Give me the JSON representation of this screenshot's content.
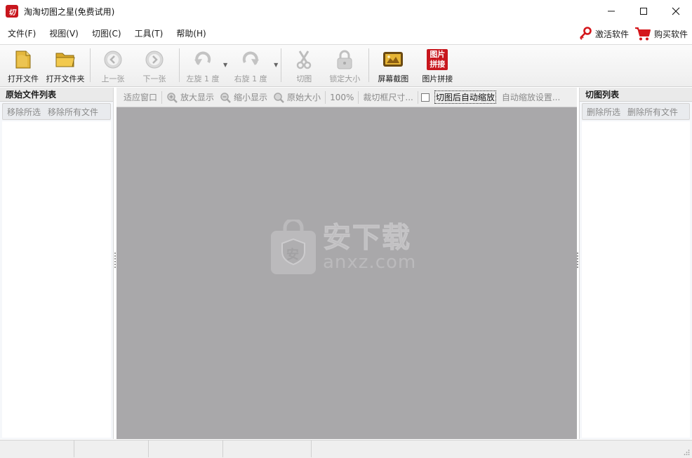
{
  "window": {
    "title": "淘淘切图之星(免费试用)",
    "logo_text": "切"
  },
  "menu": {
    "items": [
      {
        "label": "文件(F)"
      },
      {
        "label": "视图(V)"
      },
      {
        "label": "切图(C)"
      },
      {
        "label": "工具(T)"
      },
      {
        "label": "帮助(H)"
      }
    ],
    "activate": "激活软件",
    "buy": "购买软件"
  },
  "toolbar": {
    "open_file": "打开文件",
    "open_folder": "打开文件夹",
    "prev": "上一张",
    "next": "下一张",
    "rotate_left": "左旋 1 度",
    "rotate_right": "右旋 1 度",
    "cut": "切图",
    "lock_size": "锁定大小",
    "screen_capture": "屏幕截图",
    "stitch": "图片拼接",
    "stitch_icon_text": "图片拼接"
  },
  "left_panel": {
    "title": "原始文件列表",
    "remove_selected": "移除所选",
    "remove_all": "移除所有文件"
  },
  "view_toolbar": {
    "fit_window": "适应窗口",
    "zoom_in": "放大显示",
    "zoom_out": "缩小显示",
    "original_size": "原始大小",
    "zoom_level": "100%",
    "crop_size": "裁切框尺寸...",
    "auto_zoom_after_cut": "切图后自动缩放",
    "auto_zoom_settings": "自动缩放设置..."
  },
  "canvas": {
    "watermark_cn": "安下载",
    "watermark_en": "anxz.com",
    "watermark_badge": "安"
  },
  "right_panel": {
    "title": "切图列表",
    "delete_selected": "删除所选",
    "delete_all": "删除所有文件"
  },
  "colors": {
    "brand_red": "#c8161d",
    "canvas_gray": "#a9a8aa",
    "icon_gold": "#e0b53c"
  }
}
